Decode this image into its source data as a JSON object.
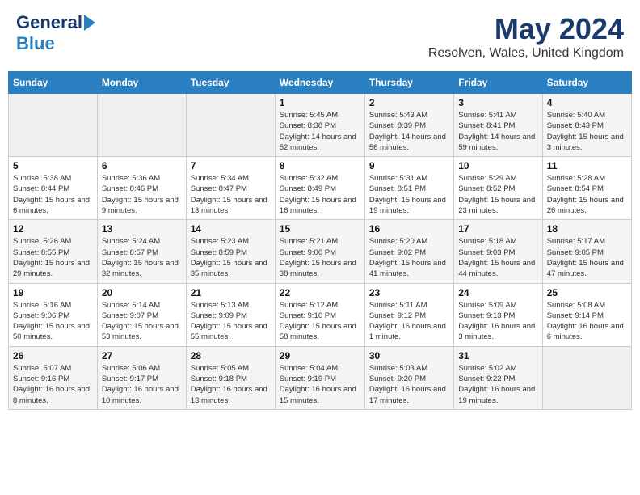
{
  "header": {
    "logo_general": "General",
    "logo_blue": "Blue",
    "month": "May 2024",
    "location": "Resolven, Wales, United Kingdom"
  },
  "weekdays": [
    "Sunday",
    "Monday",
    "Tuesday",
    "Wednesday",
    "Thursday",
    "Friday",
    "Saturday"
  ],
  "weeks": [
    [
      {
        "day": "",
        "info": ""
      },
      {
        "day": "",
        "info": ""
      },
      {
        "day": "",
        "info": ""
      },
      {
        "day": "1",
        "info": "Sunrise: 5:45 AM\nSunset: 8:38 PM\nDaylight: 14 hours and 52 minutes."
      },
      {
        "day": "2",
        "info": "Sunrise: 5:43 AM\nSunset: 8:39 PM\nDaylight: 14 hours and 56 minutes."
      },
      {
        "day": "3",
        "info": "Sunrise: 5:41 AM\nSunset: 8:41 PM\nDaylight: 14 hours and 59 minutes."
      },
      {
        "day": "4",
        "info": "Sunrise: 5:40 AM\nSunset: 8:43 PM\nDaylight: 15 hours and 3 minutes."
      }
    ],
    [
      {
        "day": "5",
        "info": "Sunrise: 5:38 AM\nSunset: 8:44 PM\nDaylight: 15 hours and 6 minutes."
      },
      {
        "day": "6",
        "info": "Sunrise: 5:36 AM\nSunset: 8:46 PM\nDaylight: 15 hours and 9 minutes."
      },
      {
        "day": "7",
        "info": "Sunrise: 5:34 AM\nSunset: 8:47 PM\nDaylight: 15 hours and 13 minutes."
      },
      {
        "day": "8",
        "info": "Sunrise: 5:32 AM\nSunset: 8:49 PM\nDaylight: 15 hours and 16 minutes."
      },
      {
        "day": "9",
        "info": "Sunrise: 5:31 AM\nSunset: 8:51 PM\nDaylight: 15 hours and 19 minutes."
      },
      {
        "day": "10",
        "info": "Sunrise: 5:29 AM\nSunset: 8:52 PM\nDaylight: 15 hours and 23 minutes."
      },
      {
        "day": "11",
        "info": "Sunrise: 5:28 AM\nSunset: 8:54 PM\nDaylight: 15 hours and 26 minutes."
      }
    ],
    [
      {
        "day": "12",
        "info": "Sunrise: 5:26 AM\nSunset: 8:55 PM\nDaylight: 15 hours and 29 minutes."
      },
      {
        "day": "13",
        "info": "Sunrise: 5:24 AM\nSunset: 8:57 PM\nDaylight: 15 hours and 32 minutes."
      },
      {
        "day": "14",
        "info": "Sunrise: 5:23 AM\nSunset: 8:59 PM\nDaylight: 15 hours and 35 minutes."
      },
      {
        "day": "15",
        "info": "Sunrise: 5:21 AM\nSunset: 9:00 PM\nDaylight: 15 hours and 38 minutes."
      },
      {
        "day": "16",
        "info": "Sunrise: 5:20 AM\nSunset: 9:02 PM\nDaylight: 15 hours and 41 minutes."
      },
      {
        "day": "17",
        "info": "Sunrise: 5:18 AM\nSunset: 9:03 PM\nDaylight: 15 hours and 44 minutes."
      },
      {
        "day": "18",
        "info": "Sunrise: 5:17 AM\nSunset: 9:05 PM\nDaylight: 15 hours and 47 minutes."
      }
    ],
    [
      {
        "day": "19",
        "info": "Sunrise: 5:16 AM\nSunset: 9:06 PM\nDaylight: 15 hours and 50 minutes."
      },
      {
        "day": "20",
        "info": "Sunrise: 5:14 AM\nSunset: 9:07 PM\nDaylight: 15 hours and 53 minutes."
      },
      {
        "day": "21",
        "info": "Sunrise: 5:13 AM\nSunset: 9:09 PM\nDaylight: 15 hours and 55 minutes."
      },
      {
        "day": "22",
        "info": "Sunrise: 5:12 AM\nSunset: 9:10 PM\nDaylight: 15 hours and 58 minutes."
      },
      {
        "day": "23",
        "info": "Sunrise: 5:11 AM\nSunset: 9:12 PM\nDaylight: 16 hours and 1 minute."
      },
      {
        "day": "24",
        "info": "Sunrise: 5:09 AM\nSunset: 9:13 PM\nDaylight: 16 hours and 3 minutes."
      },
      {
        "day": "25",
        "info": "Sunrise: 5:08 AM\nSunset: 9:14 PM\nDaylight: 16 hours and 6 minutes."
      }
    ],
    [
      {
        "day": "26",
        "info": "Sunrise: 5:07 AM\nSunset: 9:16 PM\nDaylight: 16 hours and 8 minutes."
      },
      {
        "day": "27",
        "info": "Sunrise: 5:06 AM\nSunset: 9:17 PM\nDaylight: 16 hours and 10 minutes."
      },
      {
        "day": "28",
        "info": "Sunrise: 5:05 AM\nSunset: 9:18 PM\nDaylight: 16 hours and 13 minutes."
      },
      {
        "day": "29",
        "info": "Sunrise: 5:04 AM\nSunset: 9:19 PM\nDaylight: 16 hours and 15 minutes."
      },
      {
        "day": "30",
        "info": "Sunrise: 5:03 AM\nSunset: 9:20 PM\nDaylight: 16 hours and 17 minutes."
      },
      {
        "day": "31",
        "info": "Sunrise: 5:02 AM\nSunset: 9:22 PM\nDaylight: 16 hours and 19 minutes."
      },
      {
        "day": "",
        "info": ""
      }
    ]
  ]
}
